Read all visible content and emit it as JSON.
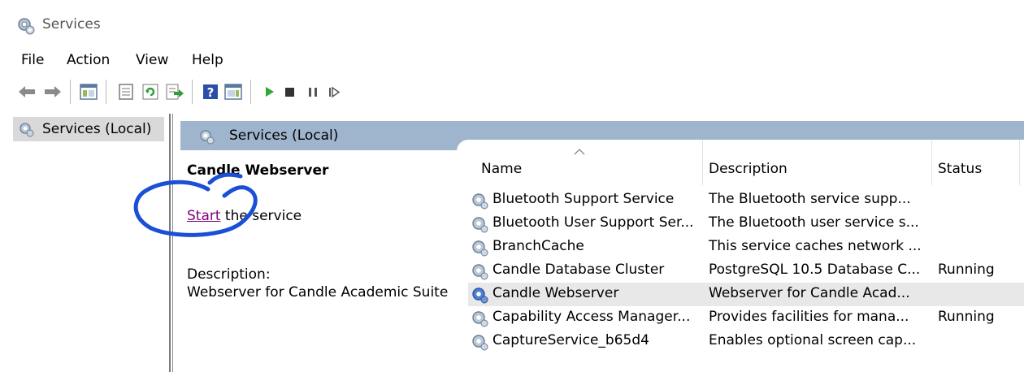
{
  "window": {
    "title": "Services"
  },
  "menu": [
    "File",
    "Action",
    "View",
    "Help"
  ],
  "toolbar": {
    "buttons": [
      "back-arrow-icon",
      "forward-arrow-icon",
      "console-tree-icon",
      "properties-icon",
      "refresh-icon",
      "export-list-icon",
      "help-icon",
      "show-hide-action-pane-icon",
      "start-service-icon",
      "stop-service-icon",
      "pause-service-icon",
      "resume-service-icon"
    ]
  },
  "tree": {
    "label": "Services (Local)"
  },
  "pane": {
    "header": "Services (Local)"
  },
  "detail": {
    "title": "Candle Webserver",
    "start_link": "Start",
    "start_rest": " the service",
    "description_label": "Description:",
    "description_text": "Webserver for Candle Academic Suite"
  },
  "table": {
    "columns": [
      "Name",
      "Description",
      "Status"
    ],
    "rows": [
      {
        "name": "Bluetooth Support Service",
        "description": "The Bluetooth service supp...",
        "status": ""
      },
      {
        "name": "Bluetooth User Support Ser...",
        "description": "The Bluetooth user service s...",
        "status": ""
      },
      {
        "name": "BranchCache",
        "description": "This service caches network ...",
        "status": ""
      },
      {
        "name": "Candle Database Cluster",
        "description": "PostgreSQL 10.5 Database C...",
        "status": "Running"
      },
      {
        "name": "Candle Webserver",
        "description": "Webserver for Candle Acad...",
        "status": ""
      },
      {
        "name": "Capability Access Manager...",
        "description": "Provides facilities for mana...",
        "status": "Running"
      },
      {
        "name": "CaptureService_b65d4",
        "description": "Enables optional screen cap...",
        "status": ""
      }
    ],
    "selected_index": 4
  },
  "colors": {
    "pane_header": "#9fb4cd",
    "link_visited": "#800080",
    "selection": "#e8e8e8",
    "annotation_ink": "#1a4fd6"
  }
}
